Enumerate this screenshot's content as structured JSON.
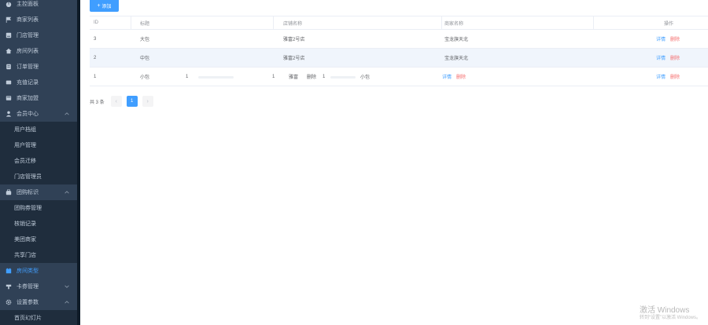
{
  "sidebar": {
    "items": [
      {
        "label": "主控面板",
        "icon": "dashboard-icon",
        "type": "top"
      },
      {
        "label": "商家列表",
        "icon": "flag-icon",
        "type": "top"
      },
      {
        "label": "门店管理",
        "icon": "store-icon",
        "type": "top"
      },
      {
        "label": "房间列表",
        "icon": "home-icon",
        "type": "top"
      },
      {
        "label": "订单管理",
        "icon": "order-icon",
        "type": "top"
      },
      {
        "label": "充值记录",
        "icon": "record-icon",
        "type": "top"
      },
      {
        "label": "商家加盟",
        "icon": "join-icon",
        "type": "top"
      },
      {
        "label": "会员中心",
        "icon": "user-icon",
        "type": "group"
      },
      {
        "label": "用户档组",
        "type": "sub"
      },
      {
        "label": "用户管理",
        "type": "sub"
      },
      {
        "label": "会员迁移",
        "type": "sub"
      },
      {
        "label": "门店管理员",
        "type": "sub"
      },
      {
        "label": "团购标识",
        "icon": "group-buy-icon",
        "type": "group"
      },
      {
        "label": "团购券管理",
        "type": "sub"
      },
      {
        "label": "核销记录",
        "type": "sub"
      },
      {
        "label": "美团商家",
        "type": "sub"
      },
      {
        "label": "共享门店",
        "type": "sub"
      },
      {
        "label": "房间类型",
        "icon": "room-type-icon",
        "type": "active"
      },
      {
        "label": "卡券管理",
        "icon": "coupon-icon",
        "type": "group"
      },
      {
        "label": "设置参数",
        "icon": "gear-icon",
        "type": "group"
      },
      {
        "label": "首页幻灯片",
        "type": "sub"
      }
    ]
  },
  "toolbar": {
    "add_label": "添加",
    "add_icon": "plus-icon"
  },
  "table": {
    "headers": {
      "id": "ID",
      "title": "标题",
      "store": "店铺名称",
      "merchant": "商家名称",
      "actions": "操作"
    },
    "rows": [
      {
        "id": "3",
        "title": "大包",
        "store": "雅富2号店",
        "merchant": "宝龙旗天北"
      },
      {
        "id": "2",
        "title": "中包",
        "store": "雅富2号店",
        "merchant": "宝龙旗天北"
      }
    ],
    "glitch_row": {
      "id": "1",
      "title": "小包",
      "n1": "1",
      "n2": "1",
      "store_fragment": "雅富",
      "delete_mid": "删除",
      "n3": "1",
      "title_dup": "小包"
    },
    "detail_label": "详情",
    "delete_label": "删除"
  },
  "pager": {
    "total": "共 3 条",
    "prev": "‹",
    "page": "1",
    "next": "›"
  },
  "watermark": {
    "line1": "激活 Windows",
    "line2": "转到“设置”以激活 Windows。"
  }
}
